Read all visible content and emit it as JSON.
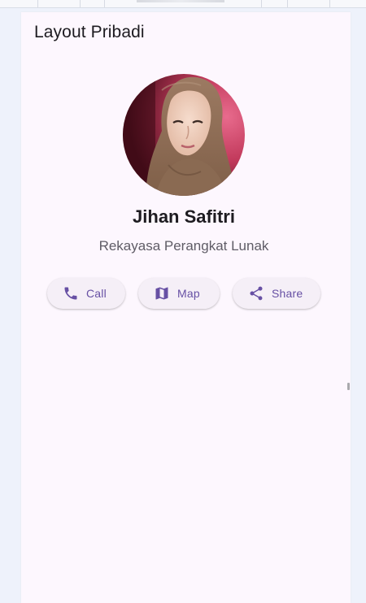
{
  "app_bar": {
    "title": "Layout Pribadi"
  },
  "profile": {
    "name": "Jihan Safitri",
    "role": "Rekayasa Perangkat Lunak",
    "avatar_icon": "profile-photo"
  },
  "actions": [
    {
      "label": "Call",
      "icon": "phone-icon"
    },
    {
      "label": "Map",
      "icon": "map-icon"
    },
    {
      "label": "Share",
      "icon": "share-icon"
    }
  ],
  "colors": {
    "page_background": "#eef2fb",
    "surface": "#fdf7fe",
    "button_background": "#f5eff7",
    "accent": "#6750a4",
    "title_text": "#1d1b20",
    "subtitle_text": "#5f5c66"
  }
}
